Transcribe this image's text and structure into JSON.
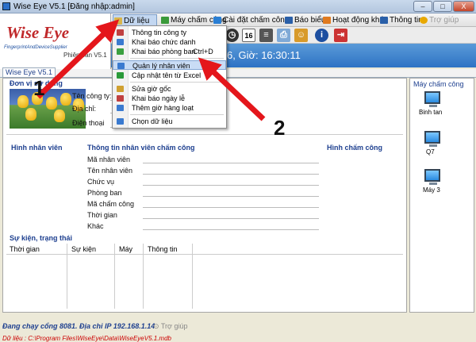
{
  "window": {
    "title": "Wise Eye V5.1 [Đăng nhập:admin]",
    "min": "–",
    "max": "□",
    "close": "X"
  },
  "logo": {
    "name": "Wise Eye",
    "sub": "FingerprintAndDeviceSupplier",
    "version": "Phiên bản V5.1"
  },
  "menu": [
    {
      "label": "Dữ liệu",
      "color": "#d9b54a"
    },
    {
      "label": "Máy chấm công",
      "color": "#3a9a3a"
    },
    {
      "label": "Cài đặt chấm công",
      "color": "#2a7fd4"
    },
    {
      "label": "Báo biểu",
      "color": "#2a5fa8"
    },
    {
      "label": "Hoạt động khác",
      "color": "#e07a1f"
    },
    {
      "label": "Thông tin",
      "color": "#2a5fa8"
    },
    {
      "label": "Trợ giúp",
      "color": "#e8a800"
    }
  ],
  "toolbar_icons": [
    "clock-icon",
    "calendar-icon",
    "notes-icon",
    "print-icon",
    "users-icon",
    "info-icon",
    "exit-icon"
  ],
  "calendar_day": "16",
  "datetime": "6, Giờ: 16:30:11",
  "tab": "Wise Eye V5.1",
  "dropdown": [
    {
      "label": "Thông tin công ty",
      "sc": "",
      "color": "#c04040"
    },
    {
      "label": "Khai báo chức danh",
      "sc": "",
      "color": "#3a7ad0"
    },
    {
      "label": "Khai báo phòng ban",
      "sc": "Ctrl+D",
      "color": "#3aa040"
    },
    {
      "sep": true
    },
    {
      "label": "Quản lý nhân viên",
      "sc": "",
      "color": "#3a7ad0",
      "hl": true
    },
    {
      "label": "Cập nhật tên từ Excel",
      "sc": "",
      "color": "#2a9a3a"
    },
    {
      "sep": true
    },
    {
      "label": "Sửa giờ gốc",
      "sc": "",
      "color": "#d0a030"
    },
    {
      "label": "Khai báo ngày lễ",
      "sc": "",
      "color": "#c04040"
    },
    {
      "label": "Thêm giờ hàng loạt",
      "sc": "",
      "color": "#3a7ad0"
    },
    {
      "sep": true
    },
    {
      "label": "Chọn dữ liệu",
      "sc": "",
      "color": "#3a7ad0"
    }
  ],
  "company": {
    "section": "Đơn vị sử dụng",
    "name_label": "Tên công ty:",
    "address_label": "Địa chỉ:",
    "phone_label": "Điện thoại"
  },
  "employee": {
    "photo_title": "Hình nhân viên",
    "info_title": "Thông tin nhân viên chấm công",
    "fields": [
      "Mã nhân viên",
      "Tên nhân viên",
      "Chức vụ",
      "Phòng ban",
      "Mã chấm công",
      "Thời gian",
      "Khác"
    ],
    "attend_photo_title": "Hình chấm công"
  },
  "events": {
    "title": "Sự kiện, trạng thái",
    "columns": [
      "Thời gian",
      "Sự kiện",
      "Máy",
      "Thông tin"
    ]
  },
  "devices": {
    "title": "Máy chấm công",
    "items": [
      "Binh tan",
      "Q7",
      "Máy 3"
    ]
  },
  "status": "Đang chạy cổng 8081. Địa chỉ IP 192.168.1.14",
  "status_help": "Trợ giúp",
  "footer": "Dữ liệu : C:\\Program Files\\WiseEye\\Data\\WiseEyeV5.1.mdb",
  "annotations": [
    "1",
    "2"
  ],
  "colors": {
    "arrow": "#e4161b",
    "accent": "#2e73c4"
  }
}
